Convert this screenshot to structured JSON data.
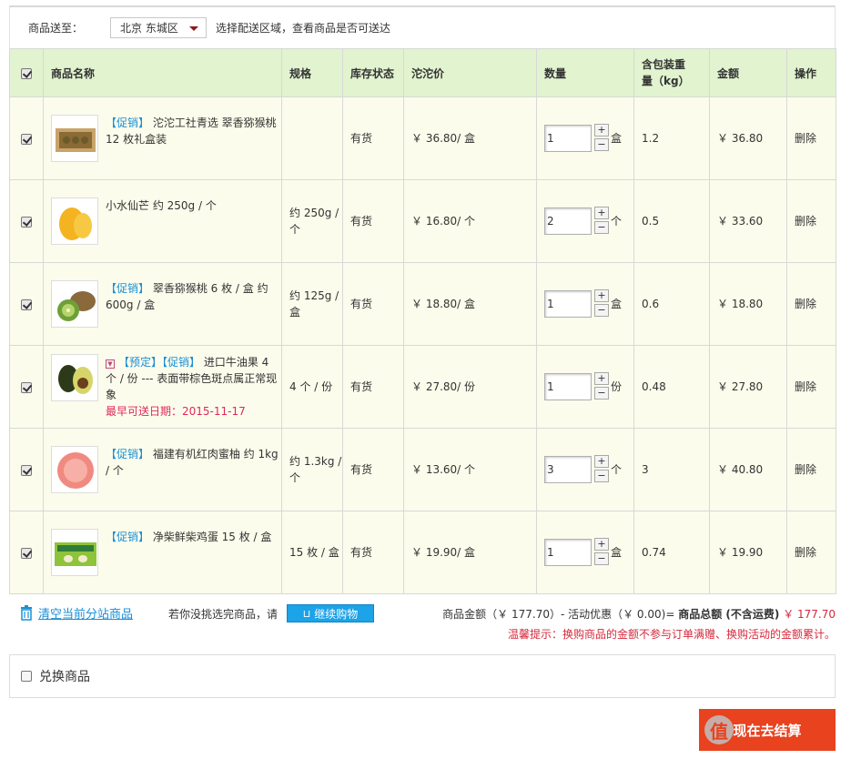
{
  "shipping": {
    "label": "商品送至：",
    "region": "北京 东城区",
    "hint": "选择配送区域，查看商品是否可送达"
  },
  "table": {
    "headers": [
      "商品名称",
      "规格",
      "库存状态",
      "沱沱价",
      "数量",
      "含包装重量（kg）",
      "金额",
      "操作"
    ],
    "rows": [
      {
        "checked": true,
        "image_icon": "kiwi-gift-box-icon",
        "tags": [
          "【促销】"
        ],
        "name": "沱沱工社青选  翠香猕猴桃 12 枚礼盒装",
        "spec": "",
        "stock": "有货",
        "price": "￥ 36.80/ 盒",
        "qty": "1",
        "unit": "盒",
        "weight": "1.2",
        "amount": "￥ 36.80",
        "action": "删除"
      },
      {
        "checked": true,
        "image_icon": "mango-icon",
        "tags": [],
        "name": "小水仙芒 约 250g / 个",
        "spec": "约 250g / 个",
        "stock": "有货",
        "price": "￥ 16.80/ 个",
        "qty": "2",
        "unit": "个",
        "weight": "0.5",
        "amount": "￥ 33.60",
        "action": "删除"
      },
      {
        "checked": true,
        "image_icon": "kiwi-icon",
        "tags": [
          "【促销】"
        ],
        "name": "翠香猕猴桃 6 枚 / 盒 约 600g / 盒",
        "spec": "约 125g / 盒",
        "stock": "有货",
        "price": "￥ 18.80/ 盒",
        "qty": "1",
        "unit": "盒",
        "weight": "0.6",
        "amount": "￥ 18.80",
        "action": "删除"
      },
      {
        "checked": true,
        "image_icon": "avocado-icon",
        "tags": [
          "【预定】",
          "【促销】"
        ],
        "name": "进口牛油果 4 个 / 份 --- 表面带棕色斑点属正常现象",
        "early_date": "最早可送日期：2015-11-17",
        "spec": "4 个 / 份",
        "stock": "有货",
        "price": "￥ 27.80/ 份",
        "qty": "1",
        "unit": "份",
        "weight": "0.48",
        "amount": "￥ 27.80",
        "action": "删除"
      },
      {
        "checked": true,
        "image_icon": "pomelo-icon",
        "tags": [
          "【促销】"
        ],
        "name": "福建有机红肉蜜柚 约 1kg / 个",
        "spec": "约 1.3kg / 个",
        "stock": "有货",
        "price": "￥ 13.60/ 个",
        "qty": "3",
        "unit": "个",
        "weight": "3",
        "amount": "￥ 40.80",
        "action": "删除"
      },
      {
        "checked": true,
        "image_icon": "egg-box-icon",
        "tags": [
          "【促销】"
        ],
        "name": "净柴鲜柴鸡蛋 15 枚 / 盒",
        "spec": "15 枚 / 盒",
        "stock": "有货",
        "price": "￥ 19.90/ 盒",
        "qty": "1",
        "unit": "盒",
        "weight": "0.74",
        "amount": "￥ 19.90",
        "action": "删除"
      }
    ]
  },
  "footer": {
    "clear_label": "清空当前分站商品",
    "not_done_hint": "若你没挑选完商品，请",
    "continue_label": "继续购物",
    "totals_prefix": "商品金额（￥ 177.70）- 活动优惠（￥ 0.00)= ",
    "totals_label": "商品总额 (不含运费)",
    "totals_amount": "￥ 177.70",
    "tip": "温馨提示：换购商品的金额不参与订单满赠、换购活动的金额累计。"
  },
  "exchange": {
    "label": "兑换商品"
  },
  "checkout": {
    "label": "现在去结算"
  },
  "colors": {
    "header_bg": "#e1f3cf",
    "row_bg": "#fcfcec",
    "link": "#1a8fd6",
    "accent_red": "#e8421f"
  }
}
